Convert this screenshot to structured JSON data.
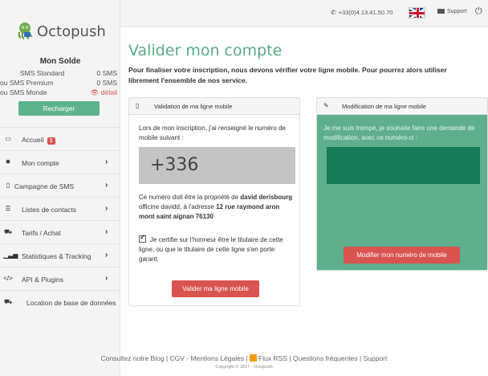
{
  "topbar": {
    "phone": "+33(0)4.13.41.50.70",
    "support_label": "Support"
  },
  "brand": {
    "name": "Octopush"
  },
  "sidebar": {
    "solde_title": "Mon Solde",
    "balances": [
      {
        "label": "SMS Standard",
        "value": "0 SMS"
      },
      {
        "label": "ou SMS Premium",
        "value": "0 SMS"
      },
      {
        "label": "ou SMS Monde",
        "value": "détail"
      }
    ],
    "recharge_label": "Recharger",
    "menu": [
      {
        "label": "Accueil",
        "badge": "1",
        "icon": "desktop-icon"
      },
      {
        "label": "Mon compte",
        "icon": "gear-icon"
      },
      {
        "label": "Campagne de SMS",
        "icon": "phone-icon"
      },
      {
        "label": "Listes de contacts",
        "icon": "list-icon"
      },
      {
        "label": "Tarifs / Achat",
        "icon": "cart-icon"
      },
      {
        "label": "Statistiques & Tracking",
        "icon": "bar-chart-icon"
      },
      {
        "label": "API & Plugins",
        "icon": "code-icon"
      },
      {
        "label": "Location de base de données",
        "icon": "cart-icon"
      }
    ]
  },
  "main": {
    "title": "Valider mon compte",
    "intro": "Pour finaliser votre inscription, nous devons vérifier votre ligne mobile. Pour pourrez alors utiliser librement l'ensemble de nos service.",
    "validation_panel": {
      "title": "Validation de ma ligne mobile",
      "text1": "Lors de mon inscription, j'ai renseigné le numéro de mobile suivant :",
      "number": "+336",
      "text2_a": "Ce numéro doit être la propriété de ",
      "text2_name": "david derisbourg",
      "text2_b": " officine davidd, à l'adresse ",
      "text2_addr": "12 rue raymond aron mont saint aignan 76130",
      "certify": "Je certifie sur l'honneur être le titulaire de cette ligne, ou que le titulaire de cette ligne s'en porte garant.",
      "button": "Valider ma ligne mobile"
    },
    "modify_panel": {
      "title": "Modification de ma ligne mobile",
      "text": "Je me suis trompé, je souhaite faire une demande de modification, avec ce numéro-ci :",
      "field_value": "",
      "button": "Modifier mon numéro de mobile"
    }
  },
  "footer": {
    "links_a": "Consultez notre Blog | CGV - Mentions Légales | ",
    "rss": "Flux RSS",
    "links_b": " | Questions fréquentes | Support",
    "copyright": "Copyright © 2017 - Octopush"
  }
}
